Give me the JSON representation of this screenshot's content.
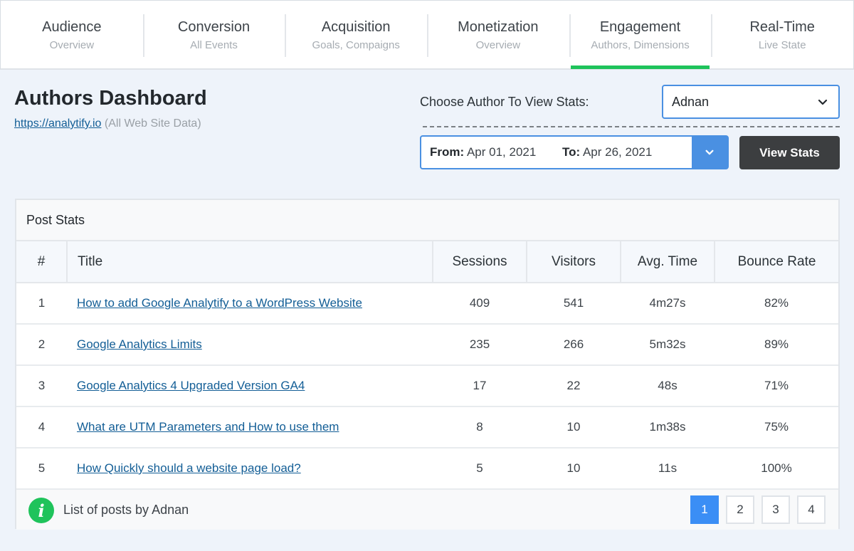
{
  "tabs": [
    {
      "title": "Audience",
      "sub": "Overview"
    },
    {
      "title": "Conversion",
      "sub": "All Events"
    },
    {
      "title": "Acquisition",
      "sub": "Goals, Compaigns"
    },
    {
      "title": "Monetization",
      "sub": "Overview"
    },
    {
      "title": "Engagement",
      "sub": "Authors, Dimensions"
    },
    {
      "title": "Real-Time",
      "sub": "Live State"
    }
  ],
  "active_tab": "Engagement",
  "header": {
    "title": "Authors Dashboard",
    "site_url": "https://analytify.io",
    "site_note": "(All Web Site Data)"
  },
  "author_picker": {
    "label": "Choose Author To View Stats:",
    "selected": "Adnan"
  },
  "date_range": {
    "from_label": "From:",
    "from": "Apr 01, 2021",
    "to_label": "To:",
    "to": "Apr 26, 2021"
  },
  "view_button": "View Stats",
  "panel": {
    "title": "Post Stats",
    "columns": [
      "#",
      "Title",
      "Sessions",
      "Visitors",
      "Avg. Time",
      "Bounce Rate"
    ],
    "rows": [
      {
        "n": "1",
        "title": "How to add Google Analytify to a WordPress Website",
        "sessions": "409",
        "visitors": "541",
        "avg": "4m27s",
        "bounce": "82%"
      },
      {
        "n": "2",
        "title": "Google Analytics Limits",
        "sessions": "235",
        "visitors": "266",
        "avg": "5m32s",
        "bounce": "89%"
      },
      {
        "n": "3",
        "title": "Google Analytics 4 Upgraded Version GA4",
        "sessions": "17",
        "visitors": "22",
        "avg": "48s",
        "bounce": "71%"
      },
      {
        "n": "4",
        "title": "What are UTM Parameters and How to use them",
        "sessions": "8",
        "visitors": "10",
        "avg": "1m38s",
        "bounce": "75%"
      },
      {
        "n": "5",
        "title": "How Quickly should a website page load?",
        "sessions": "5",
        "visitors": "10",
        "avg": "11s",
        "bounce": "100%"
      }
    ],
    "footer_text": "List of posts by Adnan",
    "info_glyph": "i",
    "pages": [
      "1",
      "2",
      "3",
      "4"
    ],
    "current_page": "1"
  },
  "colors": {
    "accent_blue": "#4a90e2",
    "active_green": "#1fc35b",
    "page_active": "#3b8ef5",
    "button_dark": "#3c3e40"
  }
}
